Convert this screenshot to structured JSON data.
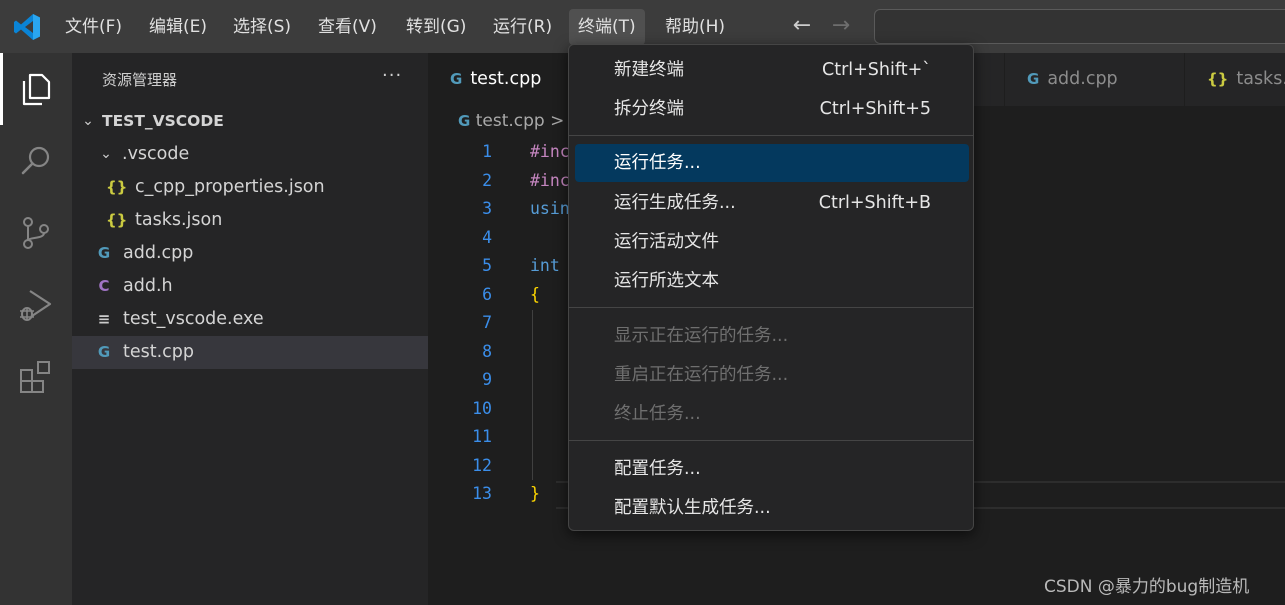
{
  "menubar": {
    "items": [
      "文件(F)",
      "编辑(E)",
      "选择(S)",
      "查看(V)",
      "转到(G)",
      "运行(R)",
      "终端(T)",
      "帮助(H)"
    ],
    "active": "终端(T)"
  },
  "sidebar": {
    "title": "资源管理器",
    "more": "···",
    "root": "TEST_VSCODE",
    "folder": ".vscode",
    "files": {
      "cpp_props": "c_cpp_properties.json",
      "tasks": "tasks.json",
      "add_cpp": "add.cpp",
      "add_h": "add.h",
      "exe": "test_vscode.exe",
      "test_cpp": "test.cpp"
    },
    "selected": "test.cpp"
  },
  "tabs": {
    "active": "test.cpp",
    "add": "add.cpp",
    "tasks": "tasks.json"
  },
  "breadcrumb": {
    "file": "test.cpp",
    "sep": ">"
  },
  "editor": {
    "line_numbers": [
      "1",
      "2",
      "3",
      "4",
      "5",
      "6",
      "7",
      "8",
      "9",
      "10",
      "11",
      "12",
      "13"
    ],
    "code": {
      "l1": "#inc",
      "l2": "#inc",
      "l3": "usin",
      "l5": "int",
      "l6": "{",
      "l13": "}"
    }
  },
  "terminal_menu": {
    "new_terminal": "新建终端",
    "new_terminal_key": "Ctrl+Shift+`",
    "split_terminal": "拆分终端",
    "split_terminal_key": "Ctrl+Shift+5",
    "run_task": "运行任务...",
    "run_build_task": "运行生成任务...",
    "run_build_task_key": "Ctrl+Shift+B",
    "run_active_file": "运行活动文件",
    "run_selected_text": "运行所选文本",
    "show_running_tasks": "显示正在运行的任务...",
    "restart_running_task": "重启正在运行的任务...",
    "terminate_task": "终止任务...",
    "configure_tasks": "配置任务...",
    "configure_default_build_task": "配置默认生成任务..."
  },
  "icons": {
    "json": "json-file-icon",
    "cpp": "cpp-file-icon",
    "header": "c-header-icon",
    "exe": "binary-file-icon"
  },
  "colors": {
    "accent": "#007acc",
    "highlight": "#04395e",
    "line_numbers": "#3b8eea"
  },
  "watermark": "CSDN @暴力的bug制造机"
}
